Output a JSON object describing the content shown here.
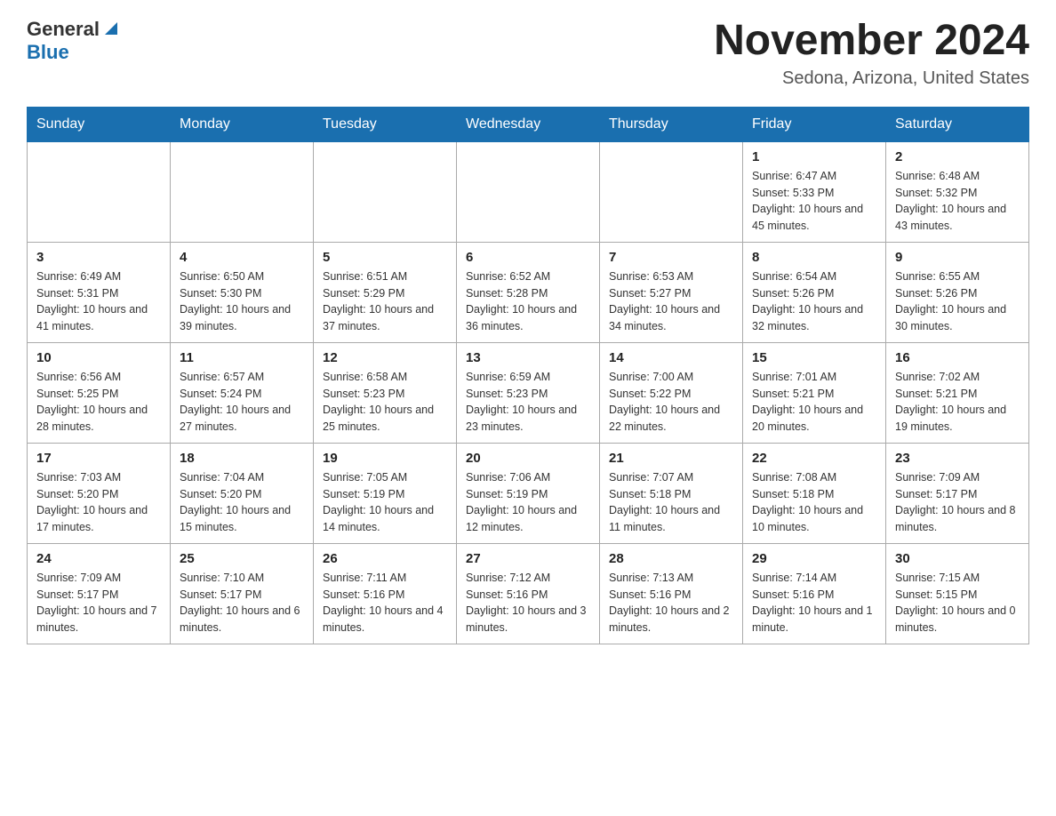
{
  "header": {
    "logo": {
      "general": "General",
      "blue": "Blue"
    },
    "title": "November 2024",
    "subtitle": "Sedona, Arizona, United States"
  },
  "calendar": {
    "days_of_week": [
      "Sunday",
      "Monday",
      "Tuesday",
      "Wednesday",
      "Thursday",
      "Friday",
      "Saturday"
    ],
    "weeks": [
      [
        {
          "day": "",
          "info": ""
        },
        {
          "day": "",
          "info": ""
        },
        {
          "day": "",
          "info": ""
        },
        {
          "day": "",
          "info": ""
        },
        {
          "day": "",
          "info": ""
        },
        {
          "day": "1",
          "info": "Sunrise: 6:47 AM\nSunset: 5:33 PM\nDaylight: 10 hours and 45 minutes."
        },
        {
          "day": "2",
          "info": "Sunrise: 6:48 AM\nSunset: 5:32 PM\nDaylight: 10 hours and 43 minutes."
        }
      ],
      [
        {
          "day": "3",
          "info": "Sunrise: 6:49 AM\nSunset: 5:31 PM\nDaylight: 10 hours and 41 minutes."
        },
        {
          "day": "4",
          "info": "Sunrise: 6:50 AM\nSunset: 5:30 PM\nDaylight: 10 hours and 39 minutes."
        },
        {
          "day": "5",
          "info": "Sunrise: 6:51 AM\nSunset: 5:29 PM\nDaylight: 10 hours and 37 minutes."
        },
        {
          "day": "6",
          "info": "Sunrise: 6:52 AM\nSunset: 5:28 PM\nDaylight: 10 hours and 36 minutes."
        },
        {
          "day": "7",
          "info": "Sunrise: 6:53 AM\nSunset: 5:27 PM\nDaylight: 10 hours and 34 minutes."
        },
        {
          "day": "8",
          "info": "Sunrise: 6:54 AM\nSunset: 5:26 PM\nDaylight: 10 hours and 32 minutes."
        },
        {
          "day": "9",
          "info": "Sunrise: 6:55 AM\nSunset: 5:26 PM\nDaylight: 10 hours and 30 minutes."
        }
      ],
      [
        {
          "day": "10",
          "info": "Sunrise: 6:56 AM\nSunset: 5:25 PM\nDaylight: 10 hours and 28 minutes."
        },
        {
          "day": "11",
          "info": "Sunrise: 6:57 AM\nSunset: 5:24 PM\nDaylight: 10 hours and 27 minutes."
        },
        {
          "day": "12",
          "info": "Sunrise: 6:58 AM\nSunset: 5:23 PM\nDaylight: 10 hours and 25 minutes."
        },
        {
          "day": "13",
          "info": "Sunrise: 6:59 AM\nSunset: 5:23 PM\nDaylight: 10 hours and 23 minutes."
        },
        {
          "day": "14",
          "info": "Sunrise: 7:00 AM\nSunset: 5:22 PM\nDaylight: 10 hours and 22 minutes."
        },
        {
          "day": "15",
          "info": "Sunrise: 7:01 AM\nSunset: 5:21 PM\nDaylight: 10 hours and 20 minutes."
        },
        {
          "day": "16",
          "info": "Sunrise: 7:02 AM\nSunset: 5:21 PM\nDaylight: 10 hours and 19 minutes."
        }
      ],
      [
        {
          "day": "17",
          "info": "Sunrise: 7:03 AM\nSunset: 5:20 PM\nDaylight: 10 hours and 17 minutes."
        },
        {
          "day": "18",
          "info": "Sunrise: 7:04 AM\nSunset: 5:20 PM\nDaylight: 10 hours and 15 minutes."
        },
        {
          "day": "19",
          "info": "Sunrise: 7:05 AM\nSunset: 5:19 PM\nDaylight: 10 hours and 14 minutes."
        },
        {
          "day": "20",
          "info": "Sunrise: 7:06 AM\nSunset: 5:19 PM\nDaylight: 10 hours and 12 minutes."
        },
        {
          "day": "21",
          "info": "Sunrise: 7:07 AM\nSunset: 5:18 PM\nDaylight: 10 hours and 11 minutes."
        },
        {
          "day": "22",
          "info": "Sunrise: 7:08 AM\nSunset: 5:18 PM\nDaylight: 10 hours and 10 minutes."
        },
        {
          "day": "23",
          "info": "Sunrise: 7:09 AM\nSunset: 5:17 PM\nDaylight: 10 hours and 8 minutes."
        }
      ],
      [
        {
          "day": "24",
          "info": "Sunrise: 7:09 AM\nSunset: 5:17 PM\nDaylight: 10 hours and 7 minutes."
        },
        {
          "day": "25",
          "info": "Sunrise: 7:10 AM\nSunset: 5:17 PM\nDaylight: 10 hours and 6 minutes."
        },
        {
          "day": "26",
          "info": "Sunrise: 7:11 AM\nSunset: 5:16 PM\nDaylight: 10 hours and 4 minutes."
        },
        {
          "day": "27",
          "info": "Sunrise: 7:12 AM\nSunset: 5:16 PM\nDaylight: 10 hours and 3 minutes."
        },
        {
          "day": "28",
          "info": "Sunrise: 7:13 AM\nSunset: 5:16 PM\nDaylight: 10 hours and 2 minutes."
        },
        {
          "day": "29",
          "info": "Sunrise: 7:14 AM\nSunset: 5:16 PM\nDaylight: 10 hours and 1 minute."
        },
        {
          "day": "30",
          "info": "Sunrise: 7:15 AM\nSunset: 5:15 PM\nDaylight: 10 hours and 0 minutes."
        }
      ]
    ]
  }
}
